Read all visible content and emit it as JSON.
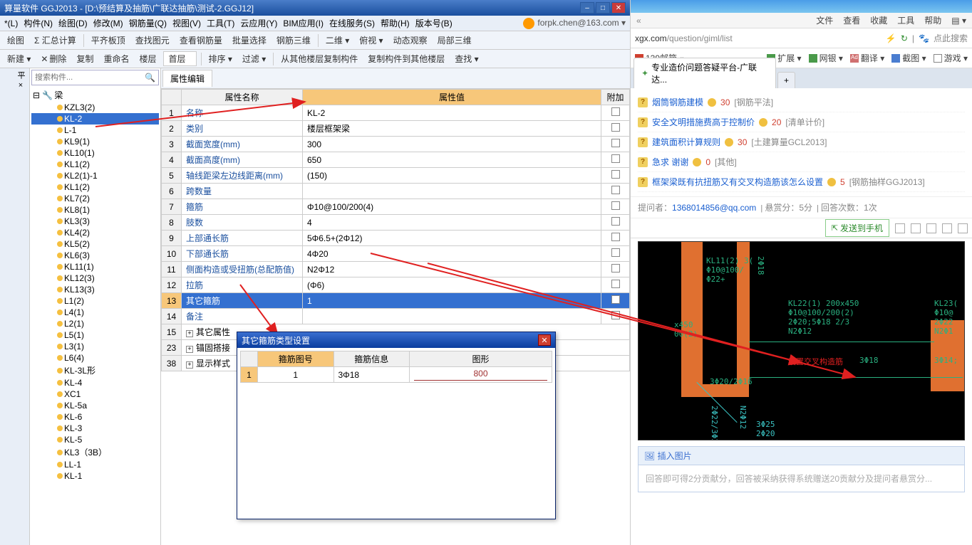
{
  "window": {
    "title": "算量软件 GGJ2013 - [D:\\预结算及抽筋\\广联达抽筋\\测试-2.GGJ12]",
    "user": "forpk.chen@163.com ▾"
  },
  "menu": [
    "*(L)",
    "构件(N)",
    "绘图(D)",
    "修改(M)",
    "钢筋量(Q)",
    "视图(V)",
    "工具(T)",
    "云应用(Y)",
    "BIM应用(I)",
    "在线服务(S)",
    "帮助(H)",
    "版本号(B)"
  ],
  "toolbar1": [
    "绘图",
    "Σ 汇总计算",
    "平齐板顶",
    "查找图元",
    "查看钢筋量",
    "批量选择",
    "钢筋三维",
    "二维 ▾",
    "俯视 ▾",
    "动态观察",
    "局部三维"
  ],
  "toolbar2": {
    "new": "新建 ▾",
    "del": "删除",
    "copy": "复制",
    "rename": "重命名",
    "floor": "楼层",
    "floor_sel": "首层",
    "sort": "排序 ▾",
    "filter": "过滤 ▾",
    "copyfrom": "从其他楼层复制构件",
    "copyto": "复制构件到其他楼层",
    "search": "查找 ▾"
  },
  "search_placeholder": "搜索构件...",
  "tree_root": "梁",
  "tree": [
    "KZL3(2)",
    "KL-2",
    "L-1",
    "KL9(1)",
    "KL10(1)",
    "KL1(2)",
    "KL2(1)-1",
    "KL1(2)",
    "KL7(2)",
    "KL8(1)",
    "KL3(3)",
    "KL4(2)",
    "KL5(2)",
    "KL6(3)",
    "KL11(1)",
    "KL12(3)",
    "KL13(3)",
    "L1(2)",
    "L4(1)",
    "L2(1)",
    "L5(1)",
    "L3(1)",
    "L6(4)",
    "KL-3L形",
    "KL-4",
    "XC1",
    "KL-5a",
    "KL-6",
    "KL-3",
    "KL-5",
    "KL3（3B）",
    "LL-1",
    "KL-1"
  ],
  "tree_selected": "KL-2",
  "prop_tab": "属性编辑",
  "prop_headers": {
    "name": "属性名称",
    "value": "属性值",
    "extra": "附加"
  },
  "props": [
    {
      "n": "1",
      "name": "名称",
      "value": "KL-2",
      "blue": true
    },
    {
      "n": "2",
      "name": "类别",
      "value": "楼层框架梁",
      "blue": true
    },
    {
      "n": "3",
      "name": "截面宽度(mm)",
      "value": "300",
      "blue": true
    },
    {
      "n": "4",
      "name": "截面高度(mm)",
      "value": "650",
      "blue": true
    },
    {
      "n": "5",
      "name": "轴线距梁左边线距离(mm)",
      "value": "(150)",
      "blue": true
    },
    {
      "n": "6",
      "name": "跨数量",
      "value": "",
      "blue": true
    },
    {
      "n": "7",
      "name": "箍筋",
      "value": "Φ10@100/200(4)",
      "blue": true
    },
    {
      "n": "8",
      "name": "肢数",
      "value": "4",
      "blue": true
    },
    {
      "n": "9",
      "name": "上部通长筋",
      "value": "5Φ6.5+(2Φ12)",
      "blue": true
    },
    {
      "n": "10",
      "name": "下部通长筋",
      "value": "4Φ20",
      "blue": true
    },
    {
      "n": "11",
      "name": "侧面构造或受扭筋(总配筋值)",
      "value": "N2Φ12",
      "blue": true
    },
    {
      "n": "12",
      "name": "拉筋",
      "value": "(Φ6)",
      "blue": true
    },
    {
      "n": "13",
      "name": "其它箍筋",
      "value": "1",
      "blue": true,
      "sel": true
    },
    {
      "n": "14",
      "name": "备注",
      "value": "",
      "blue": true
    }
  ],
  "prop_groups": [
    {
      "n": "15",
      "name": "其它属性"
    },
    {
      "n": "23",
      "name": "锚固搭接"
    },
    {
      "n": "38",
      "name": "显示样式"
    }
  ],
  "dialog": {
    "title": "其它箍筋类型设置",
    "headers": {
      "num": "箍筋图号",
      "info": "箍筋信息",
      "shape": "图形"
    },
    "row": {
      "n": "1",
      "num": "1",
      "info": "3Φ18",
      "shape": "800"
    }
  },
  "browser": {
    "menus": [
      "文件",
      "查看",
      "收藏",
      "工具",
      "帮助"
    ],
    "url_prefix": "xgx.com",
    "url_path": "/question/giml/list",
    "search_placeholder": "点此搜索",
    "favs": [
      {
        "label": "139邮箱",
        "color": "#d04030"
      },
      {
        "label": "扩展 ▾",
        "color": "#4a9a4a"
      },
      {
        "label": "网银 ▾",
        "color": "#4a9a4a"
      },
      {
        "label": "翻译 ▾",
        "color": "#d07070"
      },
      {
        "label": "截图 ▾",
        "color": "#4a7dd0"
      },
      {
        "label": "游戏 ▾",
        "color": "#888"
      }
    ],
    "tab": "专业造价问题答疑平台-广联达...",
    "qa": [
      {
        "t": "烟筒钢筋建模",
        "pts": "30",
        "cat": "[钢筋平法]"
      },
      {
        "t": "安全文明措施费高于控制价",
        "pts": "20",
        "cat": "[清单计价]"
      },
      {
        "t": "建筑面积计算规则",
        "pts": "30",
        "cat": "[土建算量GCL2013]"
      },
      {
        "t": "急求 谢谢",
        "pts": "0",
        "cat": "[其他]"
      },
      {
        "t": "框架梁既有抗扭筋又有交叉构造筋该怎么设置",
        "pts": "5",
        "cat": "[钢筋抽样GGJ2013]"
      }
    ],
    "meta": {
      "asker_label": "提问者：",
      "asker": "1368014856@qq.com",
      "bounty": "悬赏分：5分",
      "answers": "回答次数：1次"
    },
    "send": "发送到手机",
    "insert": "插入图片",
    "ans_placeholder": "回答即可得2分贡献分，回答被采纳获得系统赠送20贡献分及提问者悬赏分..."
  }
}
